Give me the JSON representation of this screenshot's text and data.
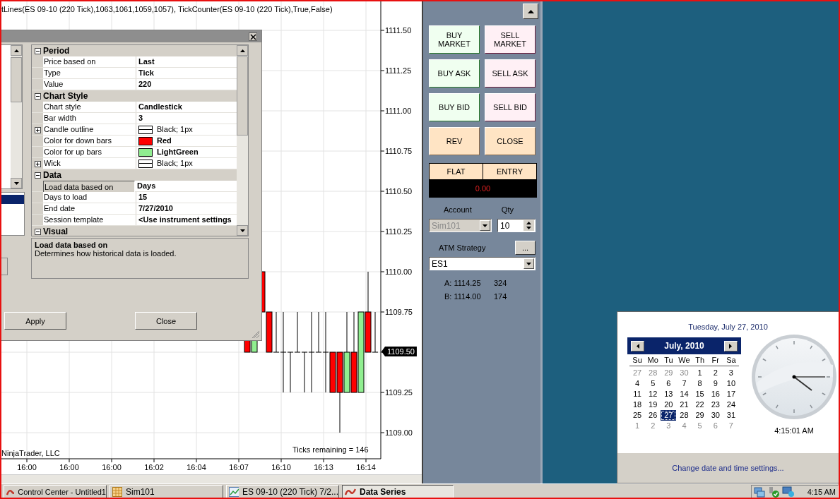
{
  "chart": {
    "indicator_line": "tLines(ES 09-10 (220 Tick),1063,1061,1059,1057), TickCounter(ES 09-10 (220 Tick),True,False)",
    "price_labels": [
      "1111.50",
      "1111.25",
      "1111.00",
      "1110.75",
      "1110.50",
      "1110.25",
      "1110.00",
      "1109.75",
      "1109.50",
      "1109.25",
      "1109.00"
    ],
    "copyright": "NinjaTrader, LLC",
    "ticks_remaining": "Ticks remaining = 146",
    "time_labels": [
      "16:00",
      "16:00",
      "16:00",
      "16:02",
      "16:04",
      "16:07",
      "16:10",
      "16:13",
      "16:14"
    ]
  },
  "dialog": {
    "sections": [
      {
        "title": "Period",
        "expanded": true,
        "rows": [
          {
            "label": "Price based on",
            "value": "Last",
            "modified": true,
            "has_children": false,
            "selected": false
          },
          {
            "label": "Type",
            "value": "Tick",
            "modified": true,
            "has_children": false,
            "selected": false
          },
          {
            "label": "Value",
            "value": "220",
            "modified": true,
            "has_children": false,
            "selected": false
          }
        ]
      },
      {
        "title": "Chart Style",
        "expanded": true,
        "rows": [
          {
            "label": "Chart style",
            "value": "Candlestick",
            "modified": true,
            "has_children": false,
            "selected": false
          },
          {
            "label": "Bar width",
            "value": "3",
            "modified": true,
            "has_children": false,
            "selected": false
          },
          {
            "label": "Candle outline",
            "value": "Black; 1px",
            "modified": false,
            "has_children": true,
            "selected": false,
            "swatch": {
              "kind": "line"
            }
          },
          {
            "label": "Color for down bars",
            "value": "Red",
            "modified": true,
            "has_children": false,
            "selected": false,
            "swatch": {
              "kind": "fill",
              "color": "#ff0000"
            }
          },
          {
            "label": "Color for up bars",
            "value": "LightGreen",
            "modified": true,
            "has_children": false,
            "selected": false,
            "swatch": {
              "kind": "fill",
              "color": "#90ee90"
            }
          },
          {
            "label": "Wick",
            "value": "Black; 1px",
            "modified": false,
            "has_children": true,
            "selected": false,
            "swatch": {
              "kind": "line"
            }
          }
        ]
      },
      {
        "title": "Data",
        "expanded": true,
        "rows": [
          {
            "label": "Load data based on",
            "value": "Days",
            "modified": true,
            "has_children": false,
            "selected": true
          },
          {
            "label": "Days to load",
            "value": "15",
            "modified": true,
            "has_children": false,
            "selected": false
          },
          {
            "label": "End date",
            "value": "7/27/2010",
            "modified": true,
            "has_children": false,
            "selected": false
          },
          {
            "label": "Session template",
            "value": "<Use instrument settings",
            "modified": true,
            "has_children": false,
            "selected": false
          }
        ]
      },
      {
        "title": "Visual",
        "expanded": true
      }
    ],
    "description": {
      "title": "Load data based on",
      "text": "Determines how historical data is loaded."
    },
    "buttons": [
      "Apply",
      "Close"
    ]
  },
  "order_panel": {
    "buttons": [
      {
        "label": "BUY MARKET",
        "kind": "buy"
      },
      {
        "label": "SELL MARKET",
        "kind": "sell"
      },
      {
        "label": "BUY ASK",
        "kind": "buy"
      },
      {
        "label": "SELL ASK",
        "kind": "sell"
      },
      {
        "label": "BUY BID",
        "kind": "buy"
      },
      {
        "label": "SELL BID",
        "kind": "sell"
      },
      {
        "label": "REV",
        "kind": "neutral"
      },
      {
        "label": "CLOSE",
        "kind": "neutral"
      }
    ],
    "position": {
      "columns": [
        "FLAT",
        "ENTRY"
      ],
      "pnl": "0.00"
    },
    "account_label": "Account",
    "account": {
      "value": "Sim101",
      "disabled": true
    },
    "qty_label": "Qty",
    "qty": "10",
    "atm_label": "ATM Strategy",
    "atm_button": "...",
    "atm_value": "ES1",
    "quotes": [
      {
        "price": "A: 1114.25",
        "size": "324"
      },
      {
        "price": "B: 1114.00",
        "size": "174"
      }
    ]
  },
  "calendar_popup": {
    "date": "Tuesday, July 27, 2010",
    "month": "July, 2010",
    "weekdays": [
      "Su",
      "Mo",
      "Tu",
      "We",
      "Th",
      "Fr",
      "Sa"
    ],
    "days": [
      {
        "text": "27",
        "other_month": true,
        "selected": false
      },
      {
        "text": "28",
        "other_month": true,
        "selected": false
      },
      {
        "text": "29",
        "other_month": true,
        "selected": false
      },
      {
        "text": "30",
        "other_month": true,
        "selected": false
      },
      {
        "text": "1",
        "other_month": false,
        "selected": false
      },
      {
        "text": "2",
        "other_month": false,
        "selected": false
      },
      {
        "text": "3",
        "other_month": false,
        "selected": false
      },
      {
        "text": "4",
        "other_month": false,
        "selected": false
      },
      {
        "text": "5",
        "other_month": false,
        "selected": false
      },
      {
        "text": "6",
        "other_month": false,
        "selected": false
      },
      {
        "text": "7",
        "other_month": false,
        "selected": false
      },
      {
        "text": "8",
        "other_month": false,
        "selected": false
      },
      {
        "text": "9",
        "other_month": false,
        "selected": false
      },
      {
        "text": "10",
        "other_month": false,
        "selected": false
      },
      {
        "text": "11",
        "other_month": false,
        "selected": false
      },
      {
        "text": "12",
        "other_month": false,
        "selected": false
      },
      {
        "text": "13",
        "other_month": false,
        "selected": false
      },
      {
        "text": "14",
        "other_month": false,
        "selected": false
      },
      {
        "text": "15",
        "other_month": false,
        "selected": false
      },
      {
        "text": "16",
        "other_month": false,
        "selected": false
      },
      {
        "text": "17",
        "other_month": false,
        "selected": false
      },
      {
        "text": "18",
        "other_month": false,
        "selected": false
      },
      {
        "text": "19",
        "other_month": false,
        "selected": false
      },
      {
        "text": "20",
        "other_month": false,
        "selected": false
      },
      {
        "text": "21",
        "other_month": false,
        "selected": false
      },
      {
        "text": "22",
        "other_month": false,
        "selected": false
      },
      {
        "text": "23",
        "other_month": false,
        "selected": false
      },
      {
        "text": "24",
        "other_month": false,
        "selected": false
      },
      {
        "text": "25",
        "other_month": false,
        "selected": false
      },
      {
        "text": "26",
        "other_month": false,
        "selected": false
      },
      {
        "text": "27",
        "other_month": false,
        "selected": true
      },
      {
        "text": "28",
        "other_month": false,
        "selected": false
      },
      {
        "text": "29",
        "other_month": false,
        "selected": false
      },
      {
        "text": "30",
        "other_month": false,
        "selected": false
      },
      {
        "text": "31",
        "other_month": false,
        "selected": false
      },
      {
        "text": "1",
        "other_month": true,
        "selected": false
      },
      {
        "text": "2",
        "other_month": true,
        "selected": false
      },
      {
        "text": "3",
        "other_month": true,
        "selected": false
      },
      {
        "text": "4",
        "other_month": true,
        "selected": false
      },
      {
        "text": "5",
        "other_month": true,
        "selected": false
      },
      {
        "text": "6",
        "other_month": true,
        "selected": false
      },
      {
        "text": "7",
        "other_month": true,
        "selected": false
      }
    ],
    "time": "4:15:01 AM",
    "link": "Change date and time settings..."
  },
  "taskbar": {
    "buttons": [
      {
        "label": "Control Center - Untitled1",
        "selected": false
      },
      {
        "label": "Sim101",
        "selected": false
      },
      {
        "label": "ES 09-10 (220 Tick)  7/2...",
        "selected": false
      },
      {
        "label": "Data Series",
        "selected": true
      }
    ],
    "clock": "4:15 AM"
  }
}
